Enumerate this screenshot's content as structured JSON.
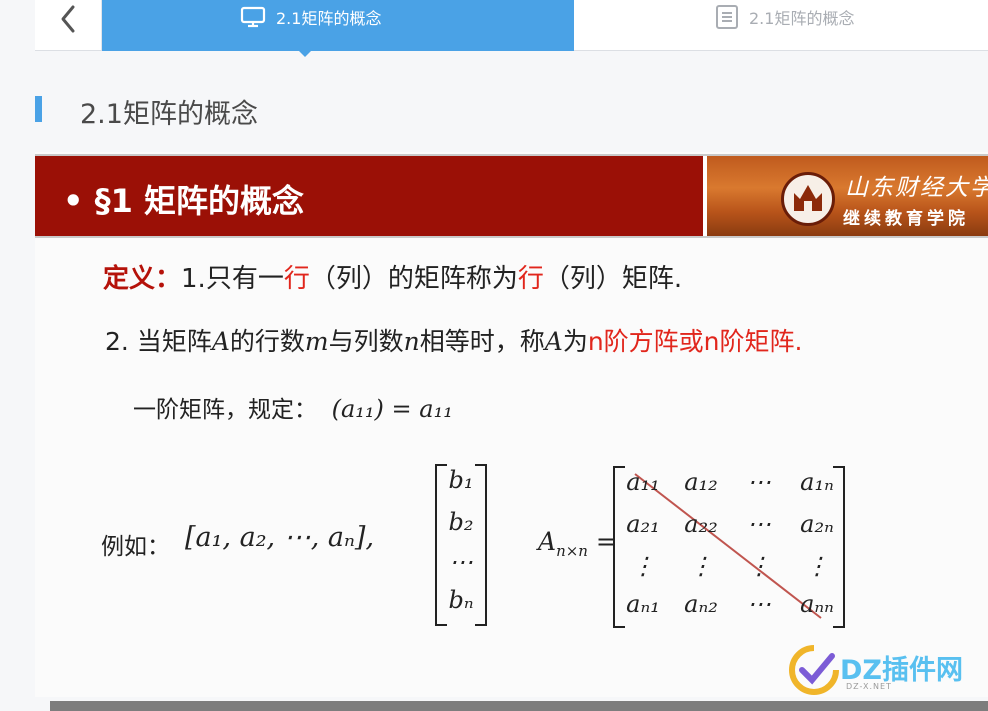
{
  "tabs": [
    {
      "label": "2.1矩阵的概念",
      "icon": "monitor-icon",
      "active": true
    },
    {
      "label": "2.1矩阵的概念",
      "icon": "document-icon",
      "active": false
    }
  ],
  "heading": "2.1矩阵的概念",
  "slide": {
    "title": "• §1 矩阵的概念",
    "logo_name": "山东财经大学",
    "logo_sub": "继续教育学院",
    "def_label": "定义：",
    "def_parts": [
      "1.只有一",
      "行",
      "（列）的矩阵称为",
      "行",
      "（列）矩阵."
    ],
    "line2_parts": [
      "2. 当矩阵",
      "A",
      "的行数",
      "m",
      "与列数",
      "n",
      "相等时，称",
      "A",
      "为",
      "n阶方阵或n阶矩阵."
    ],
    "line3_text": "一阶矩阵，规定：",
    "line3_math": "(a₁₁) = a₁₁",
    "example_label": "例如：",
    "row_vector": "[a₁,  a₂,  ⋯,  aₙ],",
    "col_vector": [
      "b₁",
      "b₂",
      "⋯",
      "bₙ"
    ],
    "a_label": "A",
    "a_sub": "n×n",
    "matrix": [
      [
        "a₁₁",
        "a₁₂",
        "⋯",
        "a₁ₙ"
      ],
      [
        "a₂₁",
        "a₂₂",
        "⋯",
        "a₂ₙ"
      ],
      [
        "⋮",
        "⋮",
        "⋮",
        "⋮"
      ],
      [
        "aₙ₁",
        "aₙ₂",
        "⋯",
        "aₙₙ"
      ]
    ]
  },
  "watermark": "DZ插件网",
  "watermark_sub": "DZ-X.NET",
  "colors": {
    "accent": "#4aa2e6",
    "slide_header": "#9b1006",
    "highlight_red": "#e1261c",
    "diagonal": "#c0554f"
  }
}
